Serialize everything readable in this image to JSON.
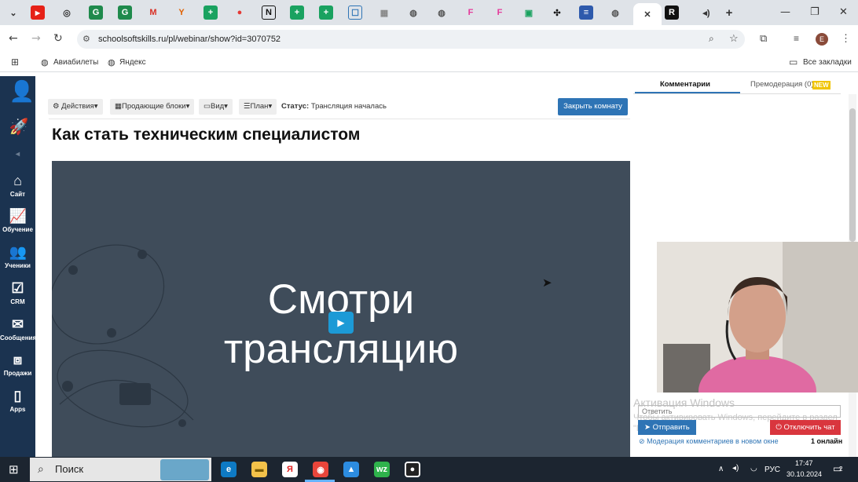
{
  "browser": {
    "url": "schoolsoftskills.ru/pl/webinar/show?id=3070752",
    "bookmarks": [
      "Авиабилеты",
      "Яндекс"
    ],
    "all_bookmarks": "Все закладки",
    "profile_initial": "E"
  },
  "sidebar": {
    "items": [
      {
        "label": "Сайт",
        "icon": "home-icon"
      },
      {
        "label": "Обучение",
        "icon": "chart-icon"
      },
      {
        "label": "Ученики",
        "icon": "users-icon"
      },
      {
        "label": "CRM",
        "icon": "checkbox-icon"
      },
      {
        "label": "Сообщения",
        "icon": "mail-icon"
      },
      {
        "label": "Продажи",
        "icon": "sales-icon"
      },
      {
        "label": "Apps",
        "icon": "phone-icon"
      }
    ]
  },
  "toolbar": {
    "actions": "Действия",
    "sell_blocks": "Продающие блоки",
    "view": "Вид",
    "plan": "План",
    "status_label": "Статус:",
    "status_value": "Трансляция началась",
    "close_room": "Закрыть комнату"
  },
  "page": {
    "title": "Как стать техническим специалистом"
  },
  "video": {
    "line1": "Смотри",
    "line2": "трансляцию"
  },
  "comments": {
    "tab_comments": "Комментарии",
    "tab_moderation": "Премодерация (0)",
    "new_badge": "NEW",
    "reply_placeholder": "Ответить",
    "send": "Отправить",
    "disconnect": "Отключить чат",
    "moderation_link": "Модерация комментариев в новом окне",
    "online": "1 онлайн"
  },
  "watermark": {
    "line1": "Активация Windows",
    "line2": "Чтобы активировать Windows, перейдите в раздел \"Параметры\"."
  },
  "taskbar": {
    "search": "Поиск",
    "lang": "РУС",
    "time": "17:47",
    "date": "30.10.2024",
    "notifications": "2"
  },
  "colors": {
    "accent": "#2e74b5",
    "sidebar": "#1b3350",
    "danger": "#d9363e",
    "video_bg": "#3f4c5a"
  }
}
